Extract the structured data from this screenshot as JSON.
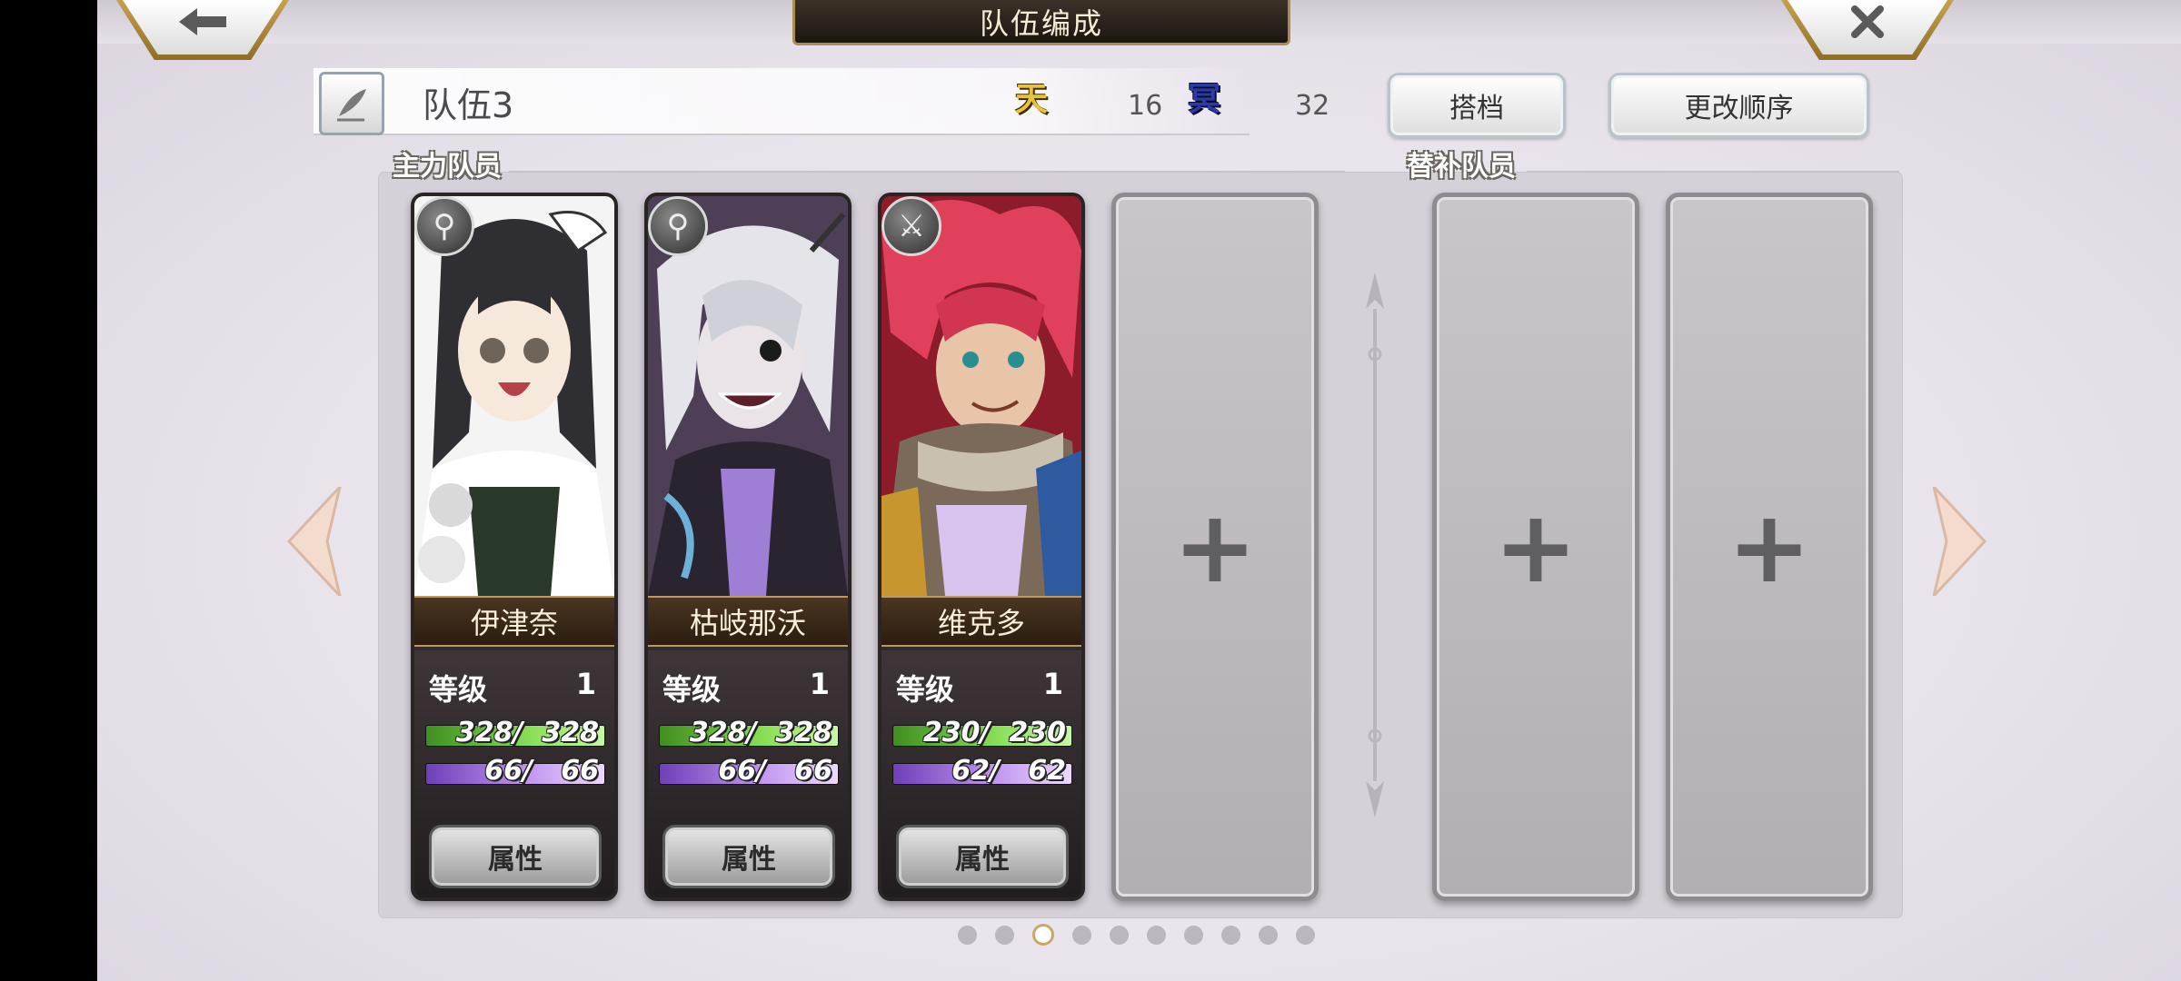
{
  "header": {
    "title": "队伍编成"
  },
  "team": {
    "name": "队伍3",
    "heaven_icon": "天",
    "heaven_count": "16",
    "dark_icon": "冥",
    "dark_count": "32"
  },
  "buttons": {
    "partner": "搭档",
    "change_order": "更改顺序"
  },
  "sections": {
    "main": "主力队员",
    "sub": "替补队员"
  },
  "members": [
    {
      "name": "伊津奈",
      "level_label": "等级",
      "level": "1",
      "hp": "328/  328",
      "hp_fraction": 1.0,
      "mp": "66/   66",
      "mp_fraction": 1.0,
      "attr_label": "属性",
      "class_icon": "staff-icon",
      "colors": {
        "hair": "#2a2a2e",
        "bg": "#f2f2f2"
      }
    },
    {
      "name": "枯岐那沃",
      "level_label": "等级",
      "level": "1",
      "hp": "328/  328",
      "hp_fraction": 1.0,
      "mp": "66/   66",
      "mp_fraction": 1.0,
      "attr_label": "属性",
      "class_icon": "staff-icon",
      "colors": {
        "hair": "#cfcfd6",
        "bg": "#5b4b63"
      }
    },
    {
      "name": "维克多",
      "level_label": "等级",
      "level": "1",
      "hp": "230/  230",
      "hp_fraction": 1.0,
      "mp": "62/   62",
      "mp_fraction": 1.0,
      "attr_label": "属性",
      "class_icon": "sword-icon",
      "colors": {
        "hair": "#d8334e",
        "bg": "#b3202f"
      }
    }
  ],
  "empty_slot_symbol": "+",
  "pagination": {
    "total": 10,
    "active_index": 2
  }
}
